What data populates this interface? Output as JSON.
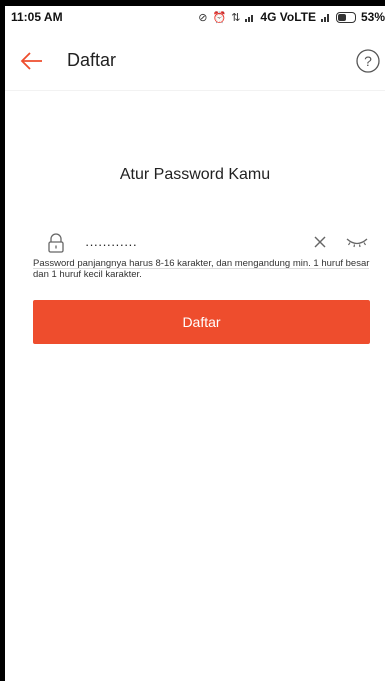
{
  "status_bar": {
    "time": "11:05 AM",
    "network": "4G VoLTE",
    "battery_percent": "53%",
    "battery_level": 0.53
  },
  "header": {
    "title": "Daftar",
    "help_label": "?"
  },
  "main": {
    "page_title": "Atur Password Kamu",
    "password_value": "············",
    "hint": "Password panjangnya harus 8-16 karakter, dan mengandung min. 1 huruf besar dan 1 huruf kecil karakter.",
    "submit_label": "Daftar"
  },
  "icons": {
    "back": "arrow-left-icon",
    "help": "question-circle-icon",
    "lock": "lock-icon",
    "clear": "close-icon",
    "visibility": "eye-closed-icon"
  },
  "colors": {
    "accent": "#ee4d2d",
    "text": "#222222",
    "divider": "#dddddd"
  }
}
